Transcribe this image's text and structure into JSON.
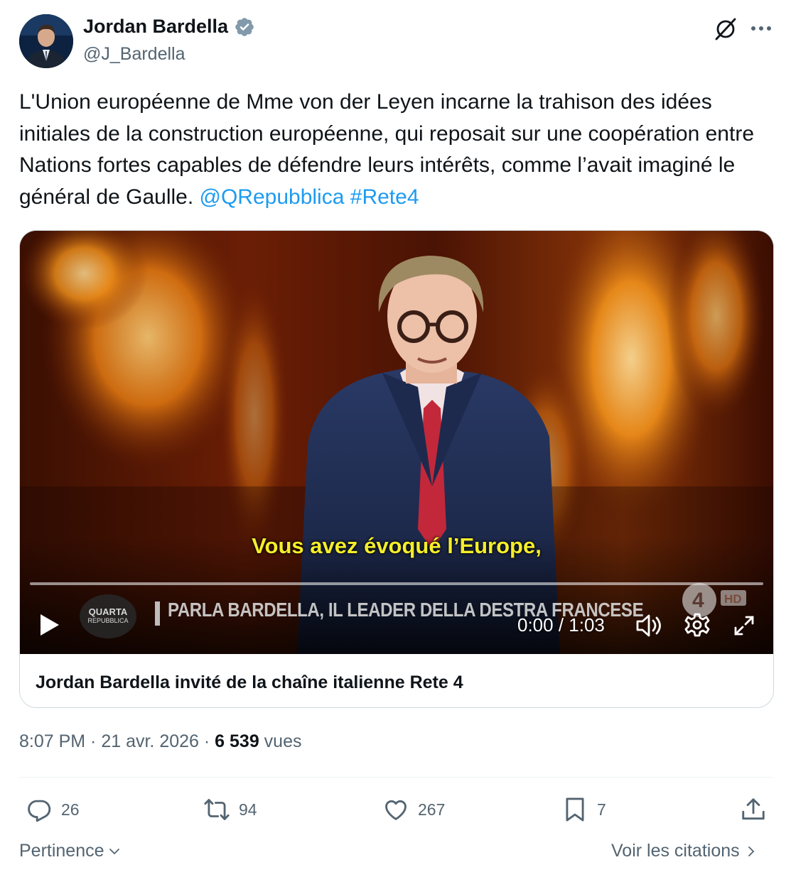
{
  "author": {
    "name": "Jordan Bardella",
    "handle": "@J_Bardella"
  },
  "tweet": {
    "text": "L'Union européenne de Mme von der Leyen incarne la trahison des idées initiales de la construction européenne, qui reposait sur une coopération entre Nations fortes capables de défendre leurs intérêts, comme l’avait imaginé le général de Gaulle.",
    "mention": "@QRepubblica",
    "hashtag": "#Rete4"
  },
  "video": {
    "subtitle": "Vous avez évoqué l’Europe,",
    "ticker": "PARLA BARDELLA, IL LEADER DELLA DESTRA FRANCESE",
    "channel_logo_main": "QUARTA",
    "channel_logo_sub": "REPUBBLICA",
    "network_badge": "HD",
    "time_display": "0:00 / 1:03",
    "progress_fraction": 0.0,
    "caption": "Jordan Bardella invité de la chaîne italienne Rete 4"
  },
  "meta": {
    "time": "8:07 PM",
    "sep1": " · ",
    "date": "21 avr. 2026",
    "sep2": " · ",
    "views_count": "6 539",
    "views_label": " vues"
  },
  "actions": {
    "replies": "26",
    "reposts": "94",
    "likes": "267",
    "bookmarks": "7"
  },
  "footer": {
    "sort_label": "Pertinence",
    "quotes_label": "Voir les citations"
  },
  "colors": {
    "link": "#1d9bf0",
    "verified": "#829aab",
    "subtitle": "#f4ee2a",
    "secondary_text": "#536471"
  }
}
